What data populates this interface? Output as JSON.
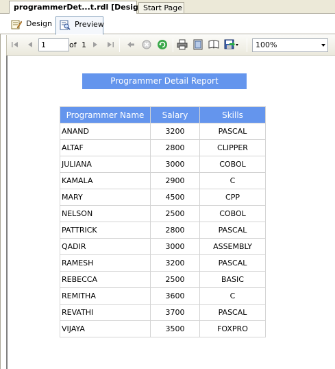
{
  "doc_tabs": [
    {
      "label": "programmerDet...t.rdl [Design]",
      "active": true
    },
    {
      "label": "Start Page",
      "active": false
    }
  ],
  "view_tabs": [
    {
      "label": "Design",
      "icon": "design-icon"
    },
    {
      "label": "Preview",
      "icon": "preview-icon"
    }
  ],
  "toolbar": {
    "page_number": "1",
    "of_label": "of",
    "total_pages": "1",
    "zoom": "100%",
    "icons": [
      "first-page-icon",
      "previous-page-icon",
      "next-page-icon",
      "last-page-icon",
      "back-icon",
      "stop-icon",
      "refresh-icon",
      "print-icon",
      "print-layout-icon",
      "page-setup-icon",
      "export-icon"
    ]
  },
  "report": {
    "title": "Programmer Detail Report",
    "columns": [
      "Programmer Name",
      "Salary",
      "Skills"
    ],
    "rows": [
      [
        "ANAND",
        "3200",
        "PASCAL"
      ],
      [
        "ALTAF",
        "2800",
        "CLIPPER"
      ],
      [
        "JULIANA",
        "3000",
        "COBOL"
      ],
      [
        "KAMALA",
        "2900",
        "C"
      ],
      [
        "MARY",
        "4500",
        "CPP"
      ],
      [
        "NELSON",
        "2500",
        "COBOL"
      ],
      [
        "PATTRICK",
        "2800",
        "PASCAL"
      ],
      [
        "QADIR",
        "3000",
        "ASSEMBLY"
      ],
      [
        "RAMESH",
        "3200",
        "PASCAL"
      ],
      [
        "REBECCA",
        "2500",
        "BASIC"
      ],
      [
        "REMITHA",
        "3600",
        "C"
      ],
      [
        "REVATHI",
        "3700",
        "PASCAL"
      ],
      [
        "VIJAYA",
        "3500",
        "FOXPRO"
      ]
    ]
  },
  "colors": {
    "header_blue": "#6495ed",
    "grid_line": "#d3d3d3"
  }
}
